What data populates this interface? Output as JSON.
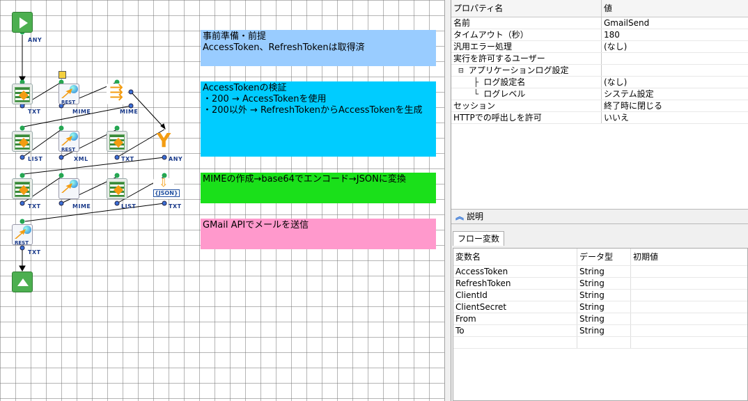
{
  "flow": {
    "notes": [
      {
        "lines": [
          "事前準備・前提",
          "AccessToken、RefreshTokenは取得済"
        ],
        "color": "#99ccff"
      },
      {
        "lines": [
          "AccessTokenの検証",
          "",
          "・200 → AccessTokenを使用",
          "",
          "",
          "・200以外 → RefreshTokenからAccessTokenを生成"
        ],
        "color": "#00ccff"
      },
      {
        "lines": [
          "MIMEの作成→base64でエンコード→JSONに変換"
        ],
        "color": "#1ae01a"
      },
      {
        "lines": [
          "GMail APIでメールを送信"
        ],
        "color": "#ff99cc"
      }
    ],
    "port_labels": {
      "any": "ANY",
      "txt": "TXT",
      "mime": "MIME",
      "list": "LIST",
      "xml": "XML",
      "rest": "REST",
      "json": "{JSON}"
    }
  },
  "properties": {
    "header": {
      "name": "プロパティ名",
      "value": "値"
    },
    "rows": [
      {
        "name": "名前",
        "value": "GmailSend",
        "indent": ""
      },
      {
        "name": "タイムアウト（秒）",
        "value": "180",
        "indent": ""
      },
      {
        "name": "汎用エラー処理",
        "value": "(なし)",
        "indent": ""
      },
      {
        "name": "実行を許可するユーザー",
        "value": "",
        "indent": ""
      },
      {
        "name": "アプリケーションログ設定",
        "value": "",
        "indent": "⊟ "
      },
      {
        "name": "ログ設定名",
        "value": "(なし)",
        "indent": "├ "
      },
      {
        "name": "ログレベル",
        "value": "システム設定",
        "indent": "└ "
      },
      {
        "name": "セッション",
        "value": "終了時に閉じる",
        "indent": ""
      },
      {
        "name": "HTTPでの呼出しを許可",
        "value": "いいえ",
        "indent": ""
      }
    ]
  },
  "description": {
    "label": "説明",
    "icon": "double-chevron-up-icon"
  },
  "flow_variables": {
    "tab": "フロー変数",
    "columns": [
      "変数名",
      "データ型",
      "初期値"
    ],
    "rows": [
      {
        "name": "AccessToken",
        "type": "String",
        "init": ""
      },
      {
        "name": "RefreshToken",
        "type": "String",
        "init": ""
      },
      {
        "name": "ClientId",
        "type": "String",
        "init": ""
      },
      {
        "name": "ClientSecret",
        "type": "String",
        "init": ""
      },
      {
        "name": "From",
        "type": "String",
        "init": ""
      },
      {
        "name": "To",
        "type": "String",
        "init": ""
      }
    ]
  }
}
